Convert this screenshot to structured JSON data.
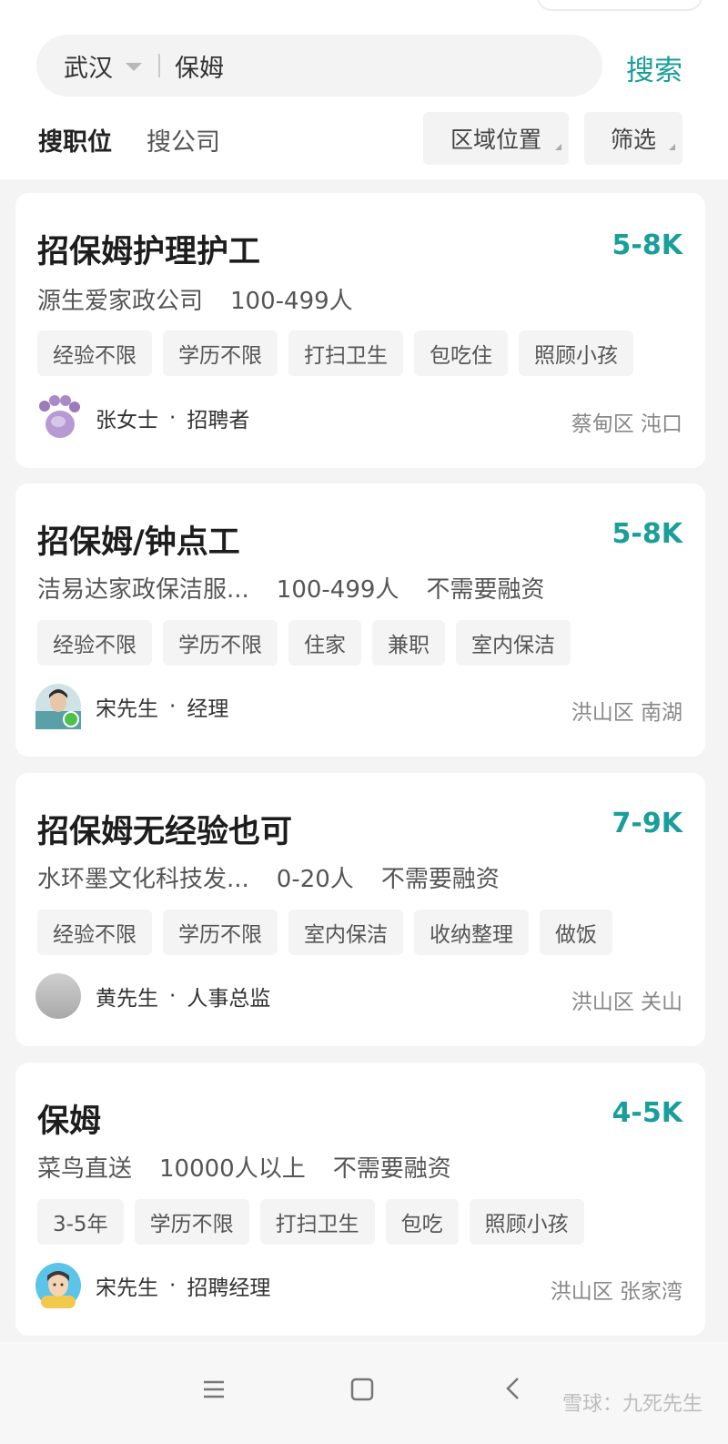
{
  "search": {
    "city": "武汉",
    "query": "保姆",
    "button_label": "搜索"
  },
  "tabs": [
    {
      "label": "搜职位",
      "active": true
    },
    {
      "label": "搜公司",
      "active": false
    }
  ],
  "filters": {
    "area_label": "区域位置",
    "filter_label": "筛选"
  },
  "jobs": [
    {
      "title": "招保姆护理护工",
      "salary": "5-8K",
      "company": "源生爱家政公司",
      "size": "100-499人",
      "funding": "",
      "tags": [
        "经验不限",
        "学历不限",
        "打扫卫生",
        "包吃住",
        "照顾小孩"
      ],
      "recruiter_name": "张女士",
      "recruiter_role": "招聘者",
      "location": "蔡甸区 沌口",
      "avatar_icon": "purple-paw-avatar"
    },
    {
      "title": "招保姆/钟点工",
      "salary": "5-8K",
      "company": "洁易达家政保洁服...",
      "size": "100-499人",
      "funding": "不需要融资",
      "tags": [
        "经验不限",
        "学历不限",
        "住家",
        "兼职",
        "室内保洁"
      ],
      "recruiter_name": "宋先生",
      "recruiter_role": "经理",
      "location": "洪山区 南湖",
      "avatar_icon": "photo-avatar-online"
    },
    {
      "title": "招保姆无经验也可",
      "salary": "7-9K",
      "company": "水环墨文化科技发...",
      "size": "0-20人",
      "funding": "不需要融资",
      "tags": [
        "经验不限",
        "学历不限",
        "室内保洁",
        "收纳整理",
        "做饭"
      ],
      "recruiter_name": "黄先生",
      "recruiter_role": "人事总监",
      "location": "洪山区 关山",
      "avatar_icon": "gray-avatar"
    },
    {
      "title": "保姆",
      "salary": "4-5K",
      "company": "菜鸟直送",
      "size": "10000人以上",
      "funding": "不需要融资",
      "tags": [
        "3-5年",
        "学历不限",
        "打扫卫生",
        "包吃",
        "照顾小孩"
      ],
      "recruiter_name": "宋先生",
      "recruiter_role": "招聘经理",
      "location": "洪山区 张家湾",
      "avatar_icon": "cartoon-man-avatar"
    }
  ],
  "separator": "·",
  "watermark": "雪球：九死先生",
  "colors": {
    "accent": "#1a9e9a",
    "card_bg": "#ffffff",
    "page_bg": "#f4f4f4",
    "tag_bg": "#f4f4f4"
  }
}
